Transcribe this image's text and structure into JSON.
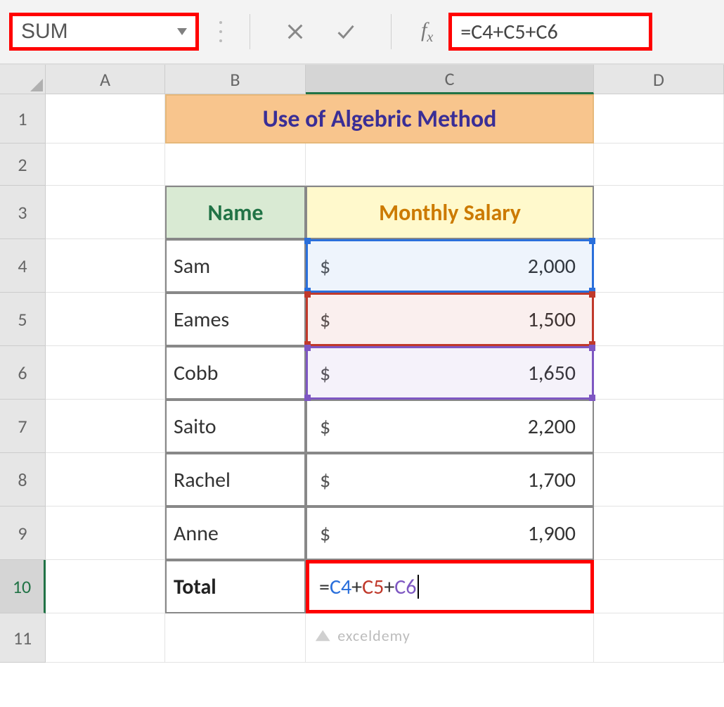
{
  "name_box": {
    "value": "SUM"
  },
  "formula_bar": {
    "cancel_title": "Cancel",
    "enter_title": "Enter",
    "fx_label": "fx",
    "formula_eq": "=",
    "ref1": "C4",
    "plus": "+",
    "ref2": "C5",
    "ref3": "C6",
    "formula_full": "=C4+C5+C6"
  },
  "columns": {
    "A": "A",
    "B": "B",
    "C": "C",
    "D": "D"
  },
  "rows": [
    "1",
    "2",
    "3",
    "4",
    "5",
    "6",
    "7",
    "8",
    "9",
    "10",
    "11"
  ],
  "title": "Use of Algebric Method",
  "headers": {
    "name": "Name",
    "salary": "Monthly Salary"
  },
  "currency": "$",
  "data": [
    {
      "name": "Sam",
      "salary": "2,000"
    },
    {
      "name": "Eames",
      "salary": "1,500"
    },
    {
      "name": "Cobb",
      "salary": "1,650"
    },
    {
      "name": "Saito",
      "salary": "2,200"
    },
    {
      "name": "Rachel",
      "salary": "1,700"
    },
    {
      "name": "Anne",
      "salary": "1,900"
    }
  ],
  "total": {
    "label": "Total",
    "eq": "=",
    "ref1": "C4",
    "plus": "+",
    "ref2": "C5",
    "ref3": "C6"
  },
  "watermark": "exceldemy"
}
